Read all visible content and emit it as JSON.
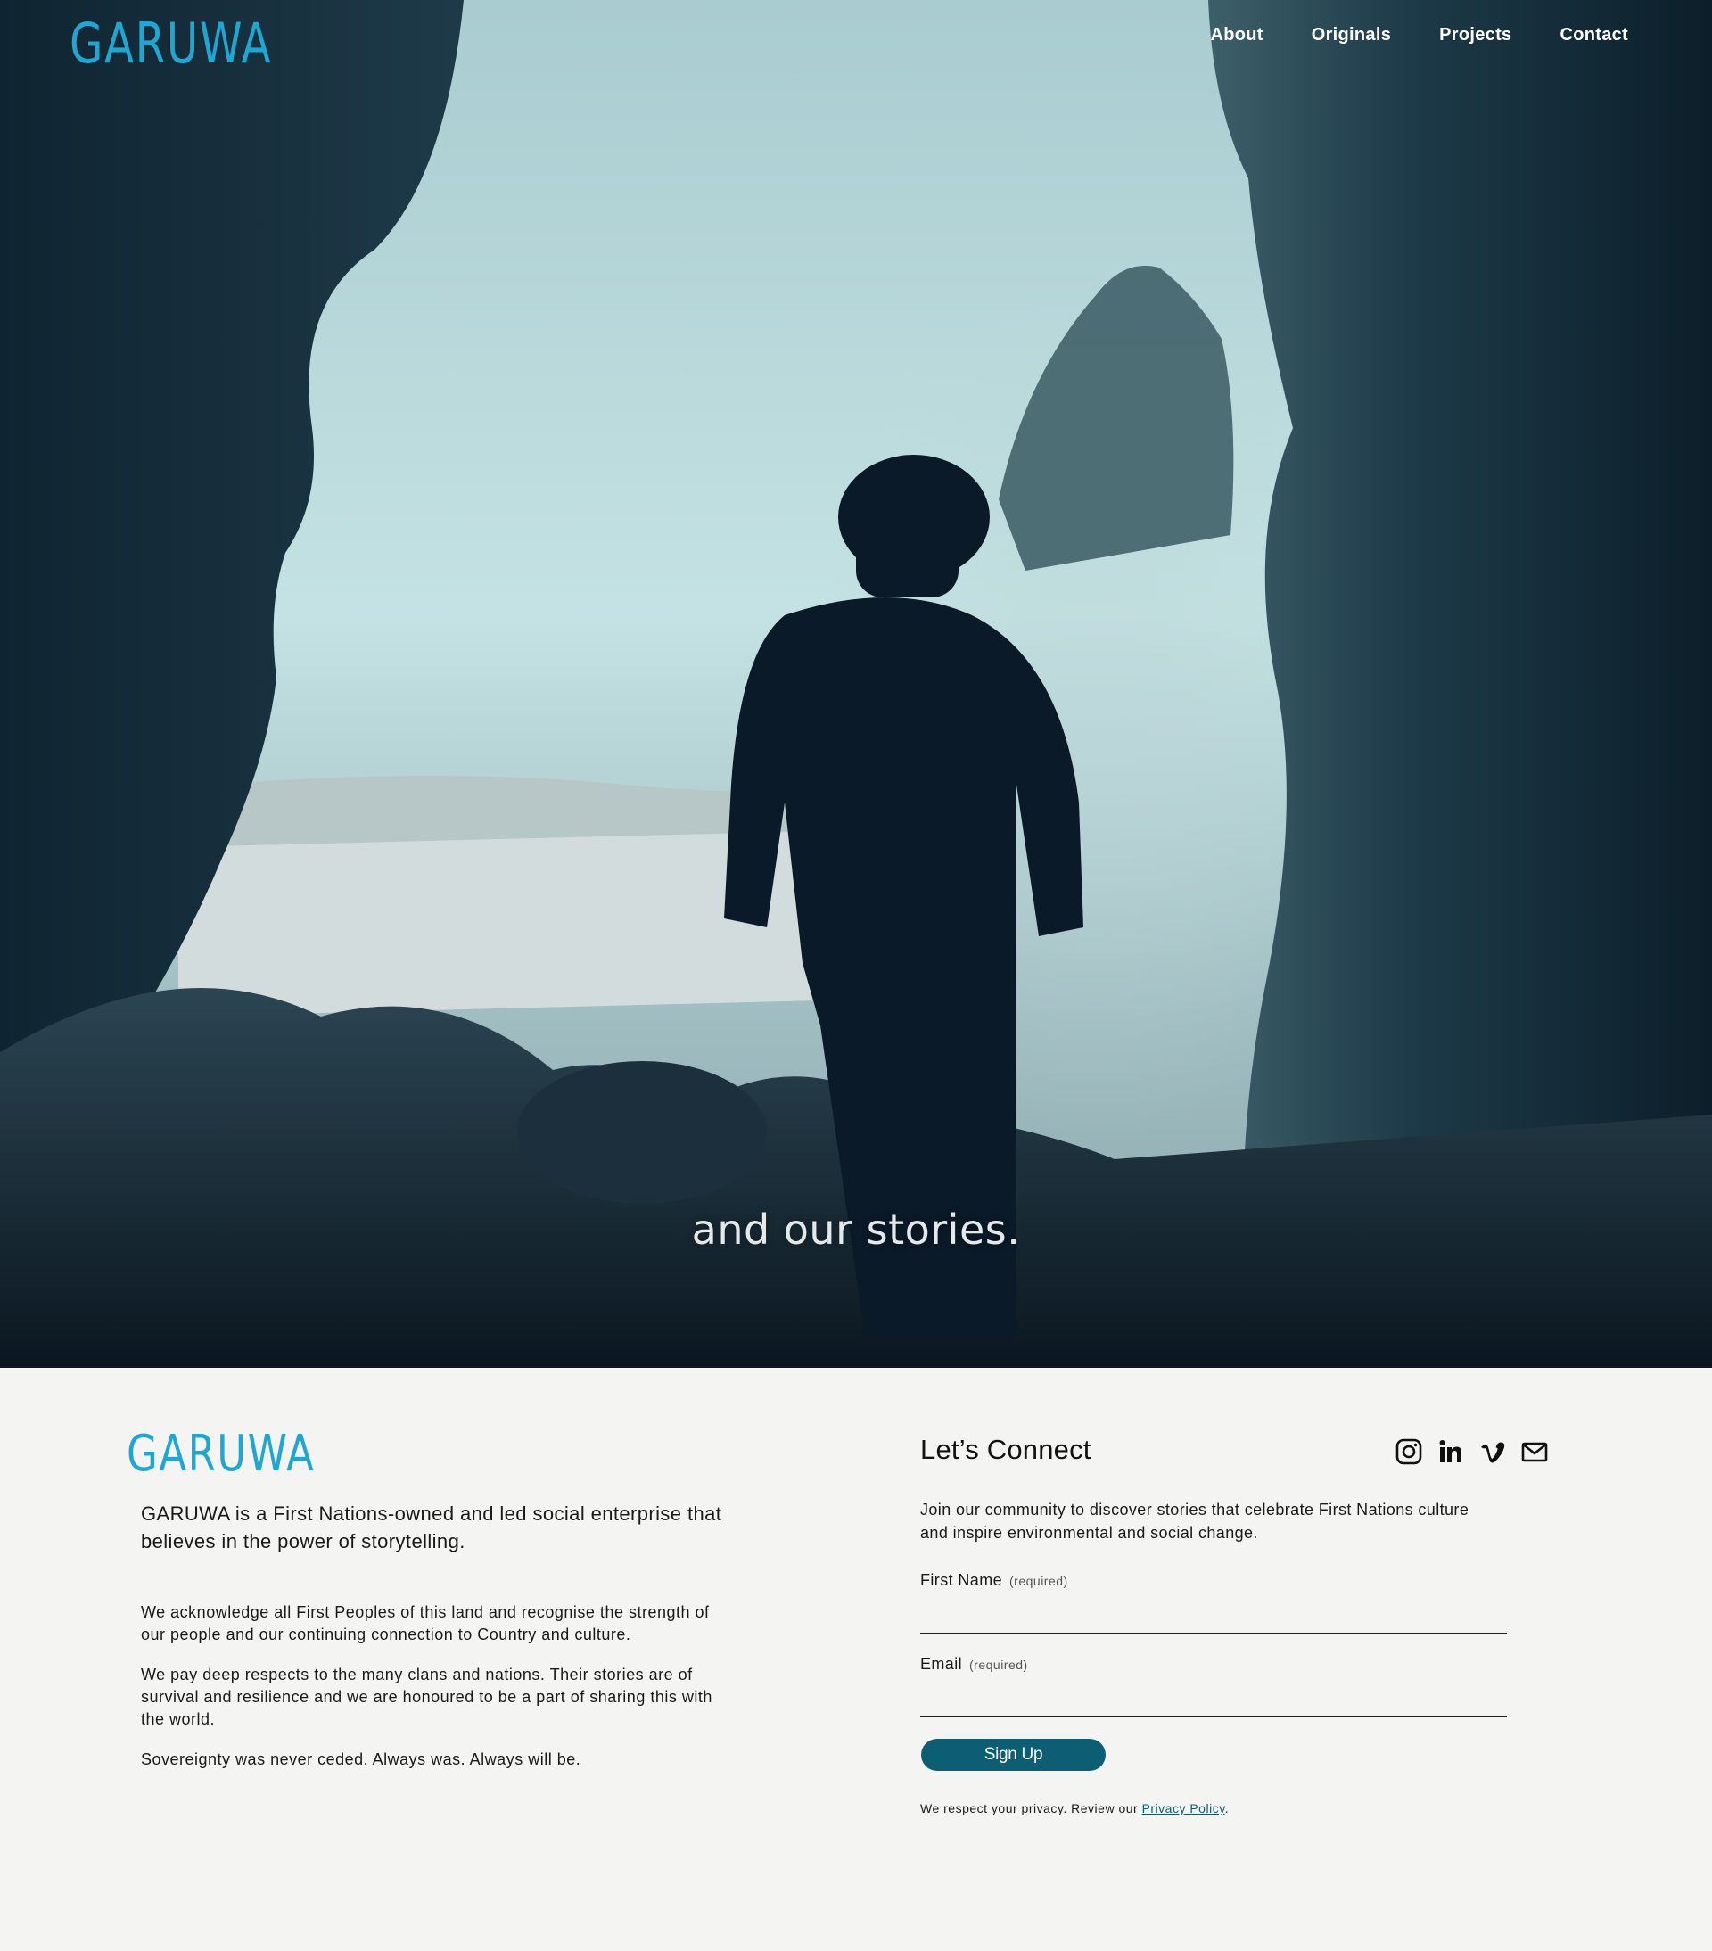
{
  "header": {
    "logo_text": "GARUWA",
    "nav": [
      "About",
      "Originals",
      "Projects",
      "Contact"
    ]
  },
  "hero": {
    "caption": "and our stories."
  },
  "footer": {
    "logo_text": "GARUWA",
    "intro": "GARUWA is a First Nations-owned and led social enterprise that believes in the power of storytelling.",
    "acknowledgement": [
      "We acknowledge all First Peoples of this land and recognise the strength of our people and our continuing connection to Country and culture.",
      "We pay deep respects to the many clans and nations. Their stories are of survival and resilience and we are honoured to be a part of sharing this with the world.",
      "Sovereignty was never ceded. Always was. Always will be."
    ],
    "connect": {
      "title": "Let’s Connect",
      "socials": [
        "instagram-icon",
        "linkedin-icon",
        "vimeo-icon",
        "email-icon"
      ],
      "description": "Join our community to discover stories that celebrate First Nations culture and inspire environmental and social change.",
      "first_name_label": "First Name",
      "email_label": "Email",
      "required_text": "(required)",
      "first_name_value": "",
      "email_value": "",
      "signup_label": "Sign Up",
      "privacy_prefix": "We respect your privacy. Review our ",
      "privacy_link": "Privacy Policy",
      "privacy_suffix": "."
    }
  },
  "colors": {
    "brand": "#1fa7d4",
    "button": "#0e5e73",
    "footer_bg": "#f4f4f2"
  }
}
